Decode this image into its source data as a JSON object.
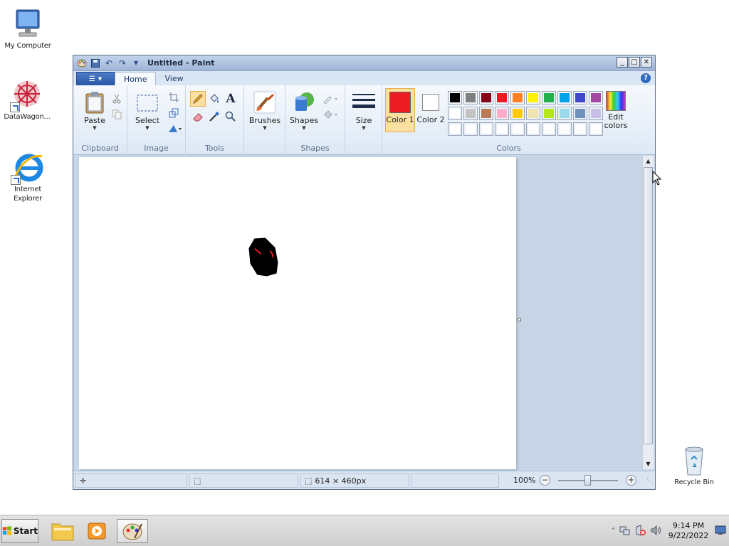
{
  "desktop": {
    "icons": [
      {
        "label": "My Computer"
      },
      {
        "label": "DataWagon..."
      },
      {
        "label": "Internet Explorer"
      },
      {
        "label": "Recycle Bin"
      }
    ]
  },
  "window": {
    "title": "Untitled - Paint",
    "tabs": {
      "home": "Home",
      "view": "View"
    },
    "help": "?"
  },
  "ribbon": {
    "clipboard": {
      "label": "Clipboard",
      "paste": "Paste"
    },
    "image": {
      "label": "Image",
      "select": "Select"
    },
    "tools": {
      "label": "Tools"
    },
    "brushes": {
      "label": "Brushes"
    },
    "shapes": {
      "label": "Shapes",
      "button": "Shapes"
    },
    "size": {
      "label": "Size"
    },
    "colors": {
      "label": "Colors",
      "color1_label": "Color 1",
      "color2_label": "Color 2",
      "color1": "#ed1c24",
      "color2": "#ffffff",
      "edit_colors": "Edit colors",
      "palette_row1": [
        "#000000",
        "#7f7f7f",
        "#880015",
        "#ed1c24",
        "#ff7f27",
        "#fff200",
        "#22b14c",
        "#00a2e8",
        "#3f48cc",
        "#a349a4"
      ],
      "palette_row2": [
        "#ffffff",
        "#c3c3c3",
        "#b97a57",
        "#ffaec9",
        "#ffc90e",
        "#efe4b0",
        "#b5e61d",
        "#99d9ea",
        "#7092be",
        "#c8bfe7"
      ],
      "palette_row3": [
        "#ffffff",
        "#ffffff",
        "#ffffff",
        "#ffffff",
        "#ffffff",
        "#ffffff",
        "#ffffff",
        "#ffffff",
        "#ffffff",
        "#ffffff"
      ]
    }
  },
  "status": {
    "image_size": "614 × 460px",
    "zoom": "100%"
  },
  "taskbar": {
    "start": "Start",
    "time": "9:14 PM",
    "date": "9/22/2022"
  }
}
